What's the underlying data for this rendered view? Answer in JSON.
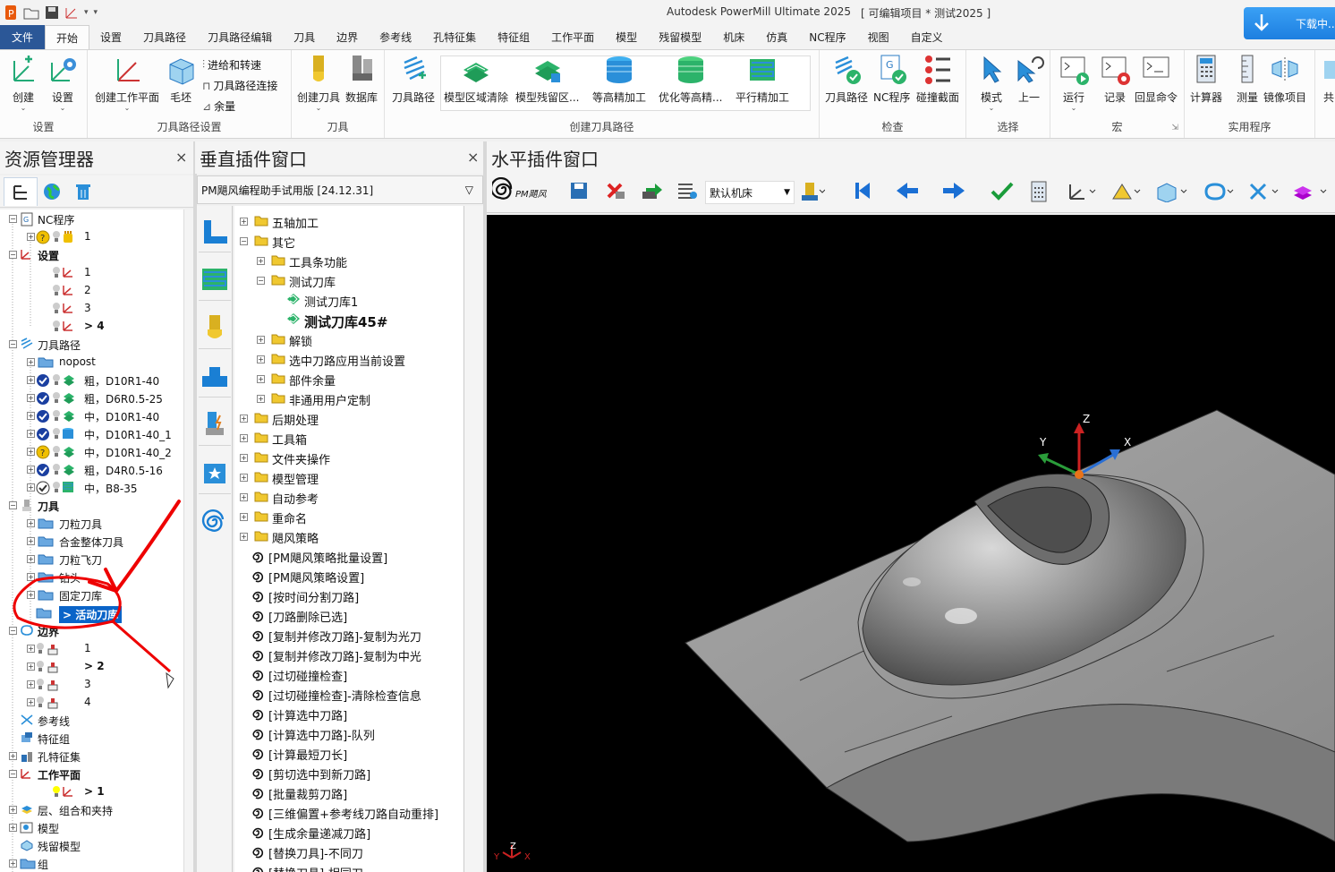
{
  "window": {
    "title": "Autodesk PowerMill Ultimate 2025",
    "project": "[ 可编辑项目 * 测试2025 ]",
    "download_label": "下载中..."
  },
  "tabs": [
    "文件",
    "开始",
    "设置",
    "刀具路径",
    "刀具路径编辑",
    "刀具",
    "边界",
    "参考线",
    "孔特征集",
    "特征组",
    "工作平面",
    "模型",
    "残留模型",
    "机床",
    "仿真",
    "NC程序",
    "视图",
    "自定义"
  ],
  "ribbon": {
    "groups": {
      "setup": "设置",
      "tp_setup": "刀具路径设置",
      "tool": "刀具",
      "create_tp": "创建刀具路径",
      "check": "检查",
      "select": "选择",
      "macro": "宏",
      "util": "实用程序"
    },
    "buttons": {
      "create": "创建",
      "setup": "设置",
      "create_wp": "创建工作平面",
      "block": "毛坯",
      "feed": "进给和转速",
      "tp_connect": "刀具路径连接",
      "stock": "余量",
      "create_tool": "创建刀具",
      "database": "数据库",
      "toolpath": "刀具路径",
      "model_area": "模型区域清除",
      "model_rest": "模型残留区...",
      "const_z": "等高精加工",
      "opt_const_z": "优化等高精...",
      "raster": "平行精加工",
      "check_tp": "刀具路径",
      "check_nc": "NC程序",
      "collision": "碰撞截面",
      "mode": "模式",
      "prev": "上一",
      "run": "运行",
      "record": "记录",
      "echo": "回显命令",
      "calc": "计算器",
      "measure": "测量",
      "mirror": "镜像项目",
      "share": "共"
    }
  },
  "explorer": {
    "title": "资源管理器",
    "close": "×",
    "rows": [
      {
        "t": "NC程序",
        "b": false
      },
      {
        "t": "1",
        "b": false
      },
      {
        "t": "设置",
        "b": true
      },
      {
        "t": "1",
        "b": false
      },
      {
        "t": "2",
        "b": false
      },
      {
        "t": "3",
        "b": false
      },
      {
        "t": "> 4",
        "b": true
      },
      {
        "t": "刀具路径",
        "b": false
      },
      {
        "t": "nopost",
        "b": false
      },
      {
        "t": "粗，D10R1-40",
        "b": false
      },
      {
        "t": "粗，D6R0.5-25",
        "b": false
      },
      {
        "t": "中，D10R1-40",
        "b": false
      },
      {
        "t": "中，D10R1-40_1",
        "b": false
      },
      {
        "t": "中，D10R1-40_2",
        "b": false
      },
      {
        "t": "粗，D4R0.5-16",
        "b": false
      },
      {
        "t": "中，B8-35",
        "b": false
      },
      {
        "t": "刀具",
        "b": true
      },
      {
        "t": "刀粒刀具",
        "b": false
      },
      {
        "t": "合金整体刀具",
        "b": false
      },
      {
        "t": "刀粒飞刀",
        "b": false
      },
      {
        "t": "钻头",
        "b": false
      },
      {
        "t": "固定刀库",
        "b": false
      },
      {
        "t": "> 活动刀库",
        "b": true
      },
      {
        "t": "边界",
        "b": true
      },
      {
        "t": "1",
        "b": false
      },
      {
        "t": "> 2",
        "b": true
      },
      {
        "t": "3",
        "b": false
      },
      {
        "t": "4",
        "b": false
      },
      {
        "t": "参考线",
        "b": false
      },
      {
        "t": "特征组",
        "b": false
      },
      {
        "t": "孔特征集",
        "b": false
      },
      {
        "t": "工作平面",
        "b": true
      },
      {
        "t": "> 1",
        "b": true
      },
      {
        "t": "层、组合和夹持",
        "b": false
      },
      {
        "t": "模型",
        "b": false
      },
      {
        "t": "残留模型",
        "b": false
      },
      {
        "t": "组",
        "b": false
      }
    ]
  },
  "vplugin": {
    "title": "垂直插件窗口",
    "close": "×",
    "header": "PM飓风编程助手试用版 [24.12.31]",
    "rows": [
      "五轴加工",
      "其它",
      "工具条功能",
      "测试刀库",
      "测试刀库1",
      "测试刀库45#",
      "解锁",
      "选中刀路应用当前设置",
      "部件余量",
      "非通用用户定制",
      "后期处理",
      "工具箱",
      "文件夹操作",
      "模型管理",
      "自动参考",
      "重命名",
      "飓风策略",
      "[PM飓风策略批量设置]",
      "[PM飓风策略设置]",
      "[按时间分割刀路]",
      "[刀路删除已选]",
      "[复制并修改刀路]-复制为光刀",
      "[复制并修改刀路]-复制为中光",
      "[过切碰撞检查]",
      "[过切碰撞检查]-清除检查信息",
      "[计算选中刀路]",
      "[计算选中刀路]-队列",
      "[计算最短刀长]",
      "[剪切选中到新刀路]",
      "[批量裁剪刀路]",
      "[三维偏置+参考线刀路自动重排]",
      "[生成余量递减刀路]",
      "[替换刀具]-不同刀",
      "[替换刀具]-相同刀"
    ]
  },
  "hplugin": {
    "title": "水平插件窗口",
    "logo": "PM飓风",
    "machine": "默认机床"
  },
  "axes": {
    "x": "X",
    "y": "Y",
    "z": "Z"
  }
}
